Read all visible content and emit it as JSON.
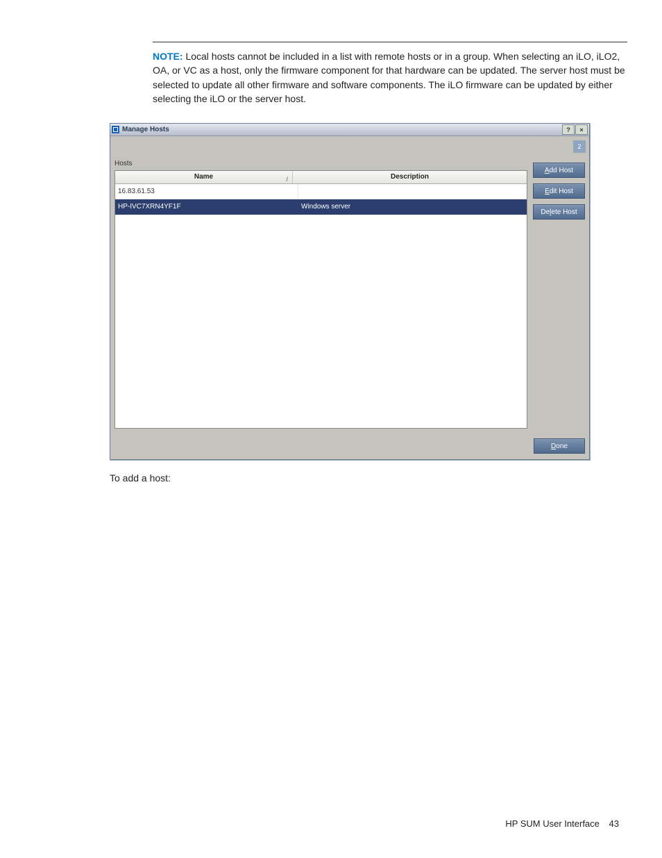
{
  "note": {
    "label": "NOTE:",
    "text": "Local hosts cannot be included in a list with remote hosts or in a group. When selecting an iLO, iLO2, OA, or VC as a host, only the firmware component for that hardware can be updated. The server host must be selected to update all other firmware and software components. The iLO firmware can be updated by either selecting the iLO or the server host."
  },
  "window": {
    "title": "Manage Hosts",
    "help_symbol": "?",
    "close_symbol": "×",
    "counter": "2",
    "hosts_label": "Hosts",
    "headers": {
      "name": "Name",
      "description": "Description"
    },
    "rows": [
      {
        "name": "16.83.61.53",
        "description": "",
        "selected": false
      },
      {
        "name": "HP-IVC7XRN4YF1F",
        "description": "Windows server",
        "selected": true
      }
    ],
    "buttons": {
      "add": {
        "u": "A",
        "rest": "dd Host"
      },
      "edit": {
        "u": "E",
        "rest": "dit Host"
      },
      "delete": {
        "pre": "De",
        "u": "l",
        "rest": "ete Host"
      },
      "done": {
        "u": "D",
        "rest": "one"
      }
    }
  },
  "after_text": "To add a host:",
  "footer": {
    "section": "HP SUM User Interface",
    "page": "43"
  }
}
